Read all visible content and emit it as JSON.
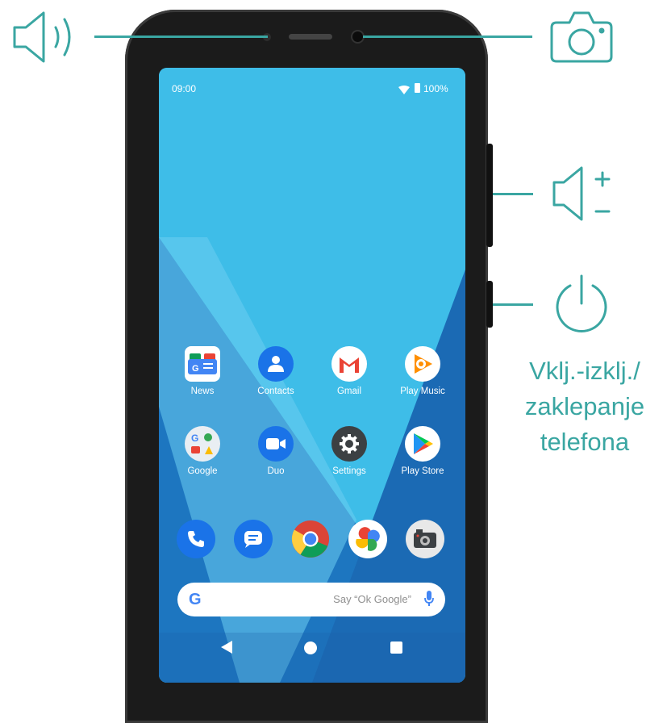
{
  "status_bar": {
    "time": "09:00",
    "battery": "100%"
  },
  "home_apps": [
    {
      "label": "News",
      "icon": "google-news-icon"
    },
    {
      "label": "Contacts",
      "icon": "contacts-icon"
    },
    {
      "label": "Gmail",
      "icon": "gmail-icon"
    },
    {
      "label": "Play Music",
      "icon": "play-music-icon"
    },
    {
      "label": "Google",
      "icon": "google-folder-icon"
    },
    {
      "label": "Duo",
      "icon": "duo-icon"
    },
    {
      "label": "Settings",
      "icon": "gear-icon"
    },
    {
      "label": "Play Store",
      "icon": "play-store-icon"
    }
  ],
  "dock": [
    "phone-icon",
    "messages-icon",
    "chrome-icon",
    "photos-icon",
    "camera-icon"
  ],
  "search": {
    "logo": "G",
    "placeholder": "Say “Ok Google”"
  },
  "callouts": {
    "earpiece": "speaker-icon",
    "front_camera": "camera-icon",
    "volume": "volume-plus-minus-icon",
    "power": "power-icon",
    "power_label_lines": [
      "Vklj.-izklj./",
      "zaklepanje",
      "telefona"
    ]
  },
  "colors": {
    "accent": "#3aa6a2",
    "screen": "#3ebde8"
  }
}
